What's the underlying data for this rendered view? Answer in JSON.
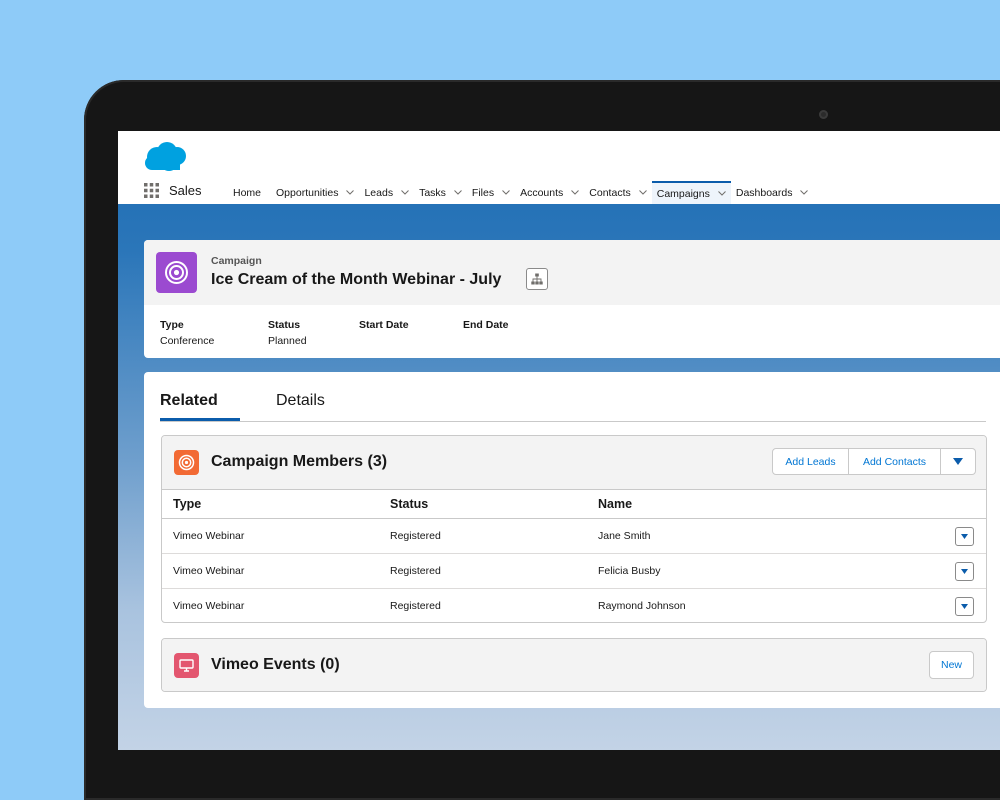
{
  "app": {
    "name": "Sales",
    "nav": [
      {
        "label": "Home",
        "dropdown": false,
        "active": false
      },
      {
        "label": "Opportunities",
        "dropdown": true,
        "active": false
      },
      {
        "label": "Leads",
        "dropdown": true,
        "active": false
      },
      {
        "label": "Tasks",
        "dropdown": true,
        "active": false
      },
      {
        "label": "Files",
        "dropdown": true,
        "active": false
      },
      {
        "label": "Accounts",
        "dropdown": true,
        "active": false
      },
      {
        "label": "Contacts",
        "dropdown": true,
        "active": false
      },
      {
        "label": "Campaigns",
        "dropdown": true,
        "active": true
      },
      {
        "label": "Dashboards",
        "dropdown": true,
        "active": false
      }
    ]
  },
  "record": {
    "object_type": "Campaign",
    "title": "Ice Cream of the Month Webinar - July",
    "fields": [
      {
        "label": "Type",
        "value": "Conference"
      },
      {
        "label": "Status",
        "value": "Planned"
      },
      {
        "label": "Start Date",
        "value": ""
      },
      {
        "label": "End Date",
        "value": ""
      }
    ]
  },
  "tabs": [
    {
      "label": "Related",
      "active": true
    },
    {
      "label": "Details",
      "active": false
    }
  ],
  "campaign_members": {
    "title": "Campaign Members (3)",
    "buttons": {
      "add_leads": "Add Leads",
      "add_contacts": "Add Contacts"
    },
    "columns": [
      "Type",
      "Status",
      "Name"
    ],
    "rows": [
      {
        "type": "Vimeo Webinar",
        "status": "Registered",
        "name": "Jane Smith"
      },
      {
        "type": "Vimeo Webinar",
        "status": "Registered",
        "name": "Felicia Busby"
      },
      {
        "type": "Vimeo Webinar",
        "status": "Registered",
        "name": "Raymond Johnson"
      }
    ]
  },
  "vimeo_events": {
    "title": "Vimeo Events (0)",
    "new_label": "New"
  },
  "colors": {
    "brand_blue": "#0b5cab",
    "link_blue": "#0176d3",
    "campaign_purple": "#9b4ad0",
    "members_orange": "#f26a34",
    "events_pink": "#e3566f",
    "salesforce_cloud": "#00a1e0"
  },
  "icons": {
    "logo": "salesforce-cloud-logo",
    "app_launcher": "app-grid-icon",
    "campaign": "target-icon",
    "hierarchy": "hierarchy-icon",
    "campaign_members": "target-icon",
    "vimeo_events": "monitor-icon",
    "dropdown": "chevron-down-icon"
  }
}
